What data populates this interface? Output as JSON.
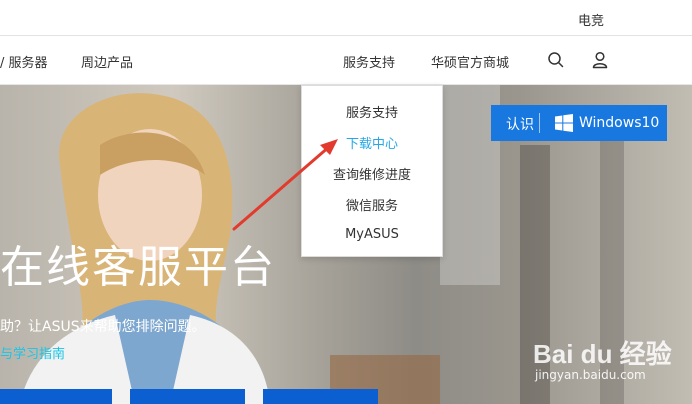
{
  "topbar": {
    "esports": "电竞"
  },
  "nav": {
    "servers": "/ 服务器",
    "peripherals": "周边产品",
    "support": "服务支持",
    "store": "华硕官方商城",
    "search_icon": "search-icon",
    "user_icon": "user-icon"
  },
  "dropdown": {
    "items": [
      {
        "label": "服务支持"
      },
      {
        "label": "下载中心",
        "active": true
      },
      {
        "label": "查询维修进度"
      },
      {
        "label": "微信服务"
      },
      {
        "label": "MyASUS"
      }
    ]
  },
  "hero": {
    "title": "在线客服平台",
    "subtitle": "助？让ASUS来帮助您排除问题。",
    "link": "与学习指南"
  },
  "win_badge": {
    "label": "认识",
    "product": "Windows10",
    "icon": "windows-logo-icon"
  },
  "watermark": {
    "brand": "Bai du 经验",
    "site": "jingyan.baidu.com"
  },
  "colors": {
    "accent_blue": "#1878e0",
    "active_link": "#26a8e6",
    "arrow_red": "#e23b2e",
    "tile_blue": "#0b5fd1"
  }
}
